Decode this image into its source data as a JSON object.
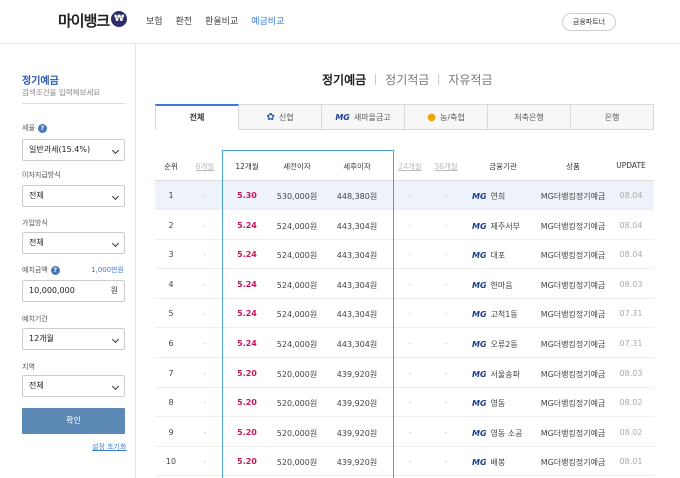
{
  "header": {
    "logo_text": "마이뱅크",
    "logo_badge": "₩",
    "nav": [
      "보험",
      "환전",
      "환율비교",
      "예금비교"
    ],
    "active_nav": 3,
    "partner_button": "금융파트너"
  },
  "sidebar": {
    "title": "정기예금",
    "subtitle": "검색조건을 입력해보세요",
    "tax_label": "세율",
    "tax_value": "일반과세(15.4%)",
    "interest_label": "이자지급방식",
    "interest_value": "전체",
    "join_label": "가입방식",
    "join_value": "전체",
    "amount_label": "예치금액",
    "amount_side": "1,000만원",
    "amount_value": "10,000,000",
    "amount_unit": "원",
    "period_label": "예치기간",
    "period_value": "12개월",
    "region_label": "지역",
    "region_value": "전체",
    "confirm": "확인",
    "reset": "설정 초기화"
  },
  "main": {
    "tabs": [
      "정기예금",
      "정기적금",
      "자유적금"
    ],
    "active_tab": 0,
    "categories": [
      {
        "label": "전체",
        "icon": ""
      },
      {
        "label": "신협",
        "icon": "✿"
      },
      {
        "label": "새마을금고",
        "icon": "MG"
      },
      {
        "label": "농/축협",
        "icon": "●"
      },
      {
        "label": "저축은행",
        "icon": ""
      },
      {
        "label": "은행",
        "icon": ""
      }
    ],
    "columns": {
      "rank": "순위",
      "m6": "6개월",
      "m12": "12개월",
      "pre_tax": "세전이자",
      "post_tax": "세후이자",
      "m24": "24개월",
      "m36": "36개월",
      "institution": "금융기관",
      "product": "상품",
      "update": "UPDATE"
    },
    "rows": [
      {
        "rank": "1",
        "m6": "-",
        "rate": "5.30",
        "pre": "530,000원",
        "post": "448,380원",
        "m24": "-",
        "m36": "-",
        "bank": "연희",
        "product": "MG더뱅킹정기예금",
        "update": "08.04"
      },
      {
        "rank": "2",
        "m6": "-",
        "rate": "5.24",
        "pre": "524,000원",
        "post": "443,304원",
        "m24": "-",
        "m36": "-",
        "bank": "제주서부",
        "product": "MG더뱅킹정기예금",
        "update": "08.04"
      },
      {
        "rank": "3",
        "m6": "-",
        "rate": "5.24",
        "pre": "524,000원",
        "post": "443,304원",
        "m24": "-",
        "m36": "-",
        "bank": "대포",
        "product": "MG더뱅킹정기예금",
        "update": "08.04"
      },
      {
        "rank": "4",
        "m6": "-",
        "rate": "5.24",
        "pre": "524,000원",
        "post": "443,304원",
        "m24": "-",
        "m36": "-",
        "bank": "한마음",
        "product": "MG더뱅킹정기예금",
        "update": "08.03"
      },
      {
        "rank": "5",
        "m6": "-",
        "rate": "5.24",
        "pre": "524,000원",
        "post": "443,304원",
        "m24": "-",
        "m36": "-",
        "bank": "고척1동",
        "product": "MG더뱅킹정기예금",
        "update": "07.31"
      },
      {
        "rank": "6",
        "m6": "-",
        "rate": "5.24",
        "pre": "524,000원",
        "post": "443,304원",
        "m24": "-",
        "m36": "-",
        "bank": "오류2동",
        "product": "MG더뱅킹정기예금",
        "update": "07.31"
      },
      {
        "rank": "7",
        "m6": "-",
        "rate": "5.20",
        "pre": "520,000원",
        "post": "439,920원",
        "m24": "-",
        "m36": "-",
        "bank": "서울송파",
        "product": "MG더뱅킹정기예금",
        "update": "08.03"
      },
      {
        "rank": "8",
        "m6": "-",
        "rate": "5.20",
        "pre": "520,000원",
        "post": "439,920원",
        "m24": "-",
        "m36": "-",
        "bank": "영동",
        "product": "MG더뱅킹정기예금",
        "update": "08.02"
      },
      {
        "rank": "9",
        "m6": "-",
        "rate": "5.20",
        "pre": "520,000원",
        "post": "439,920원",
        "m24": "-",
        "m36": "-",
        "bank": "영동 소공",
        "product": "MG더뱅킹정기예금",
        "update": "08.02"
      },
      {
        "rank": "10",
        "m6": "-",
        "rate": "5.20",
        "pre": "520,000원",
        "post": "439,920원",
        "m24": "-",
        "m36": "-",
        "bank": "배봉",
        "product": "MG더뱅킹정기예금",
        "update": "08.01"
      }
    ],
    "bank_logo": "MG"
  },
  "colors": {
    "accent": "#3a7bd5",
    "rate": "#c2185b",
    "confirm": "#5d89b7",
    "highlight_row": "#eef3fb"
  }
}
